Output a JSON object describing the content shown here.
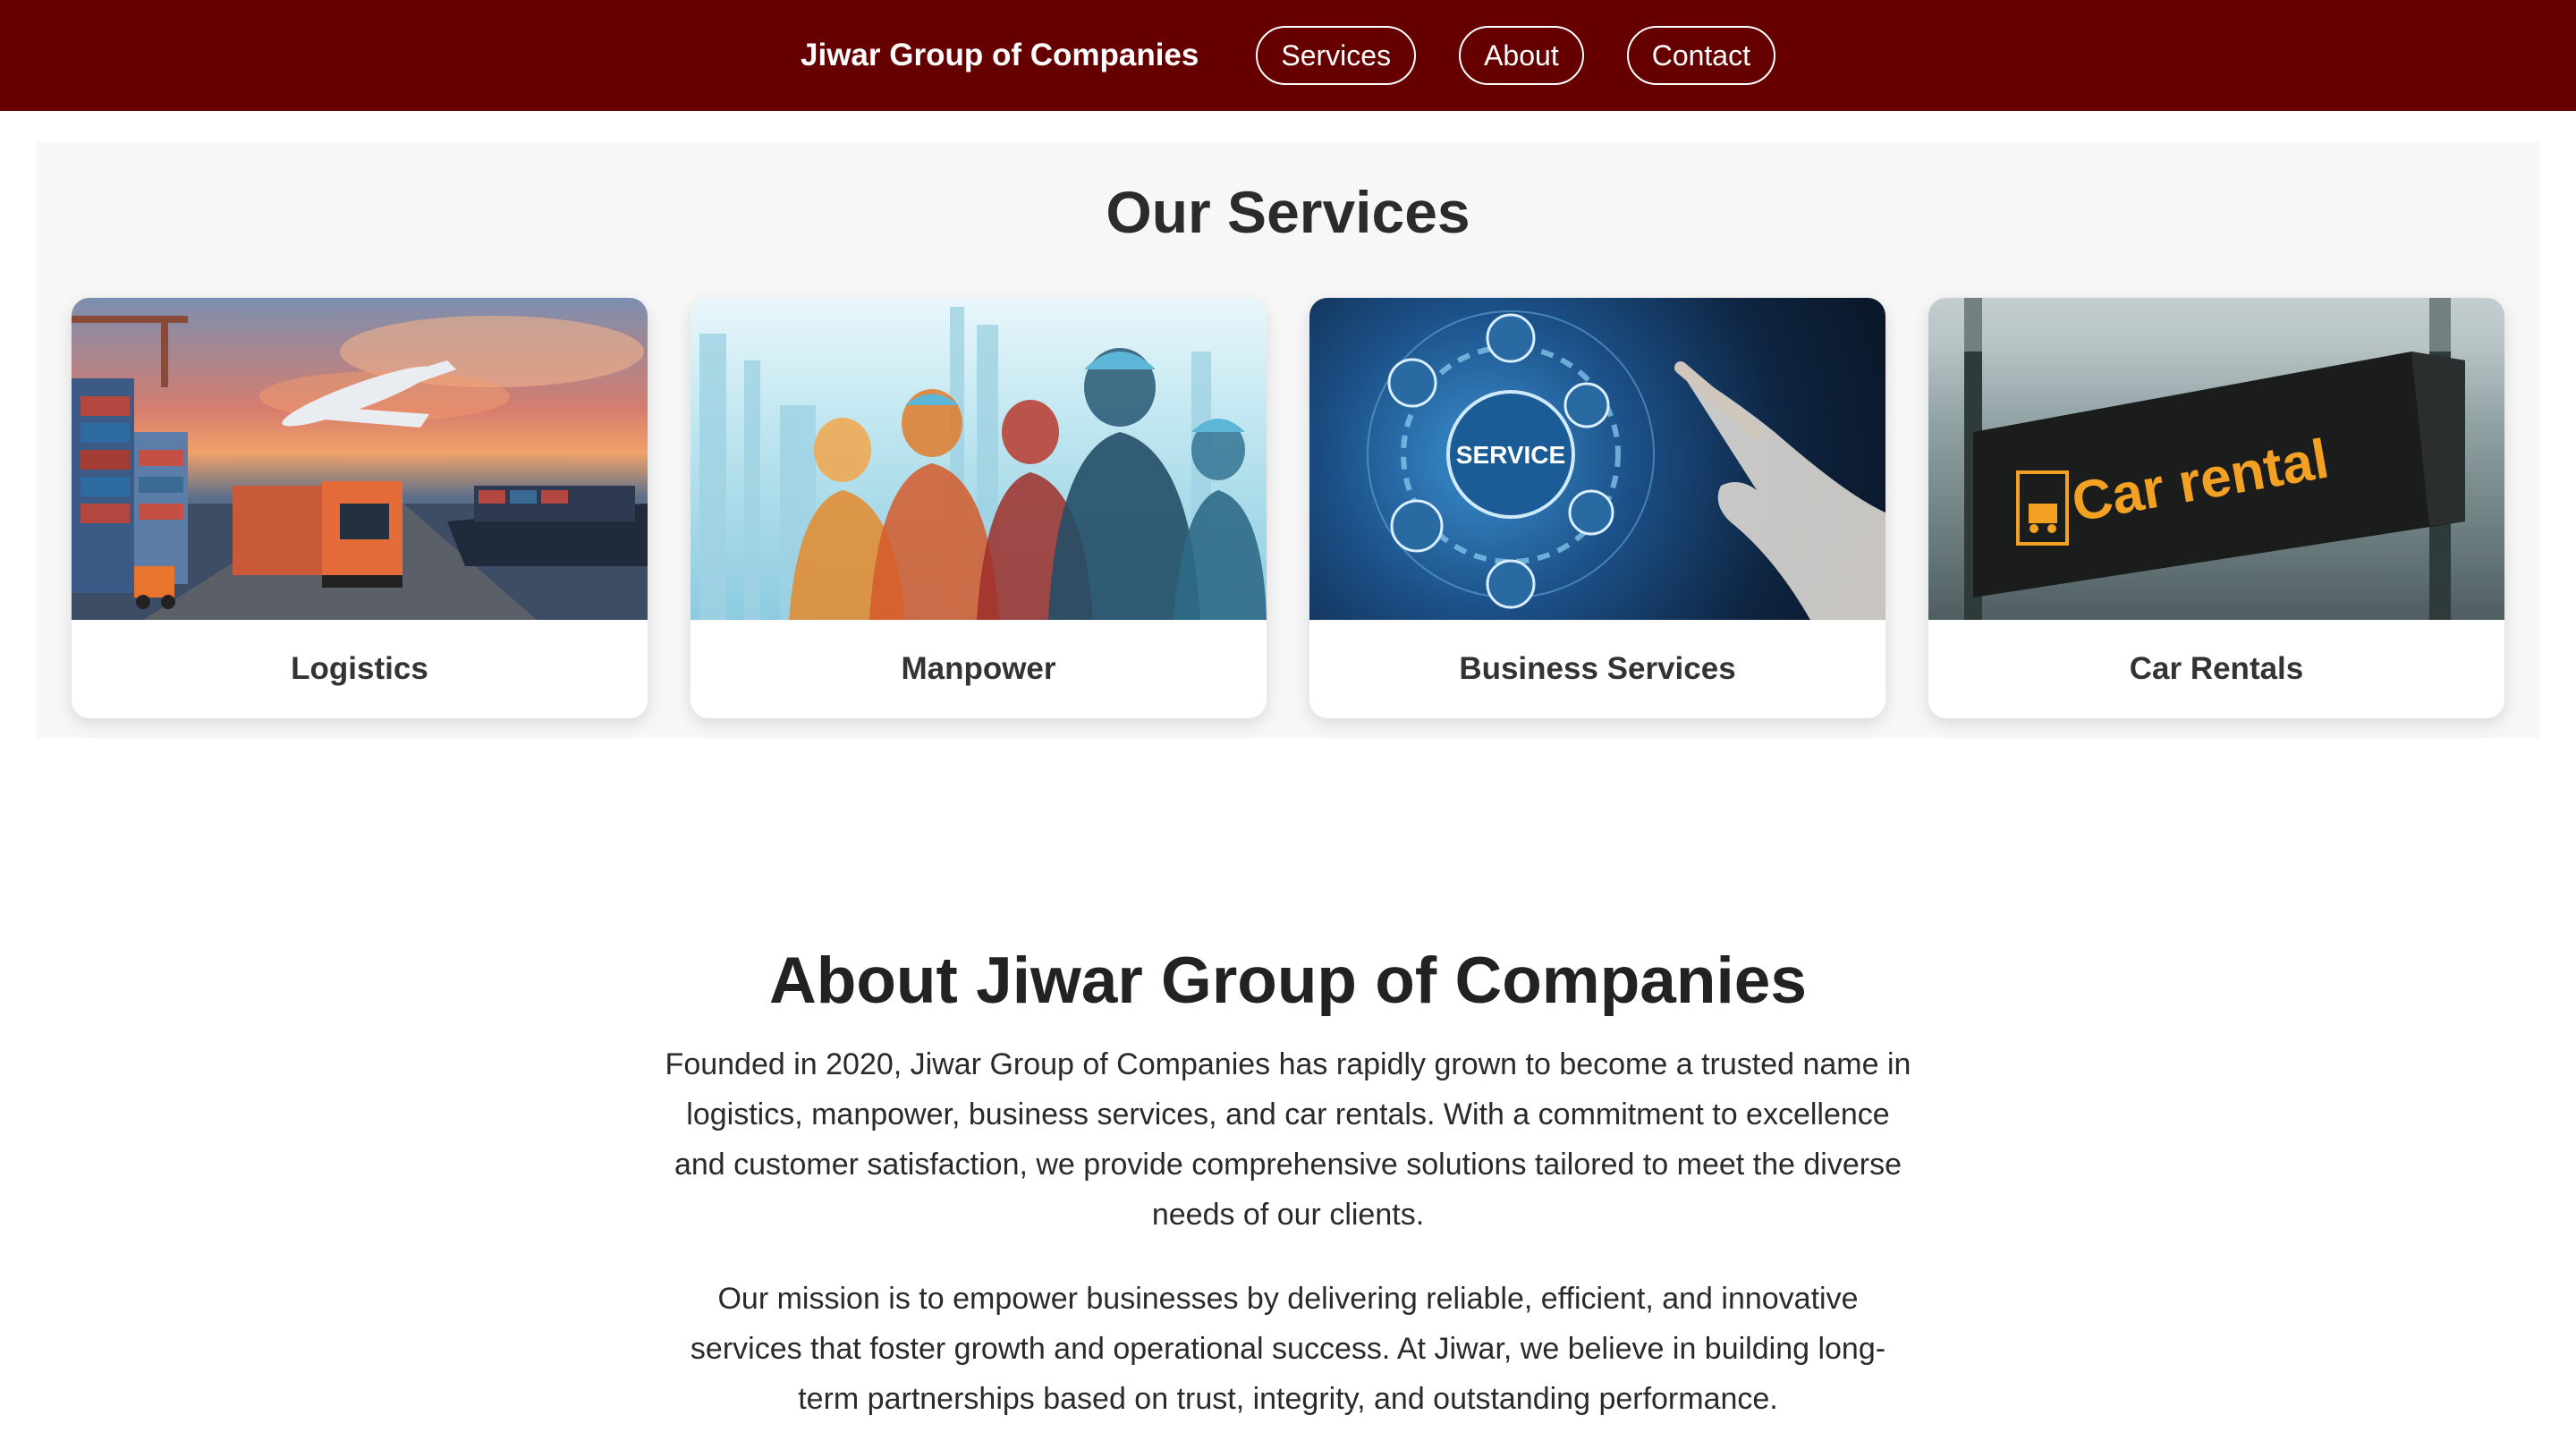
{
  "nav": {
    "brand": "Jiwar Group of Companies",
    "links": [
      "Services",
      "About",
      "Contact"
    ]
  },
  "services": {
    "heading": "Our Services",
    "cards": [
      {
        "title": "Logistics",
        "image_icon": "logistics-image"
      },
      {
        "title": "Manpower",
        "image_icon": "manpower-image"
      },
      {
        "title": "Business Services",
        "image_icon": "business-services-image",
        "image_text": "SERVICE"
      },
      {
        "title": "Car Rentals",
        "image_icon": "car-rental-image",
        "image_text": "Car rental"
      }
    ]
  },
  "about": {
    "heading": "About Jiwar Group of Companies",
    "paragraphs": [
      "Founded in 2020, Jiwar Group of Companies has rapidly grown to become a trusted name in logistics, manpower, business services, and car rentals. With a commitment to excellence and customer satisfaction, we provide comprehensive solutions tailored to meet the diverse needs of our clients.",
      "Our mission is to empower businesses by delivering reliable, efficient, and innovative services that foster growth and operational success. At Jiwar, we believe in building long-term partnerships based on trust, integrity, and outstanding performance."
    ]
  },
  "colors": {
    "navbar": "#660000",
    "accent_sign": "#f2a122"
  }
}
